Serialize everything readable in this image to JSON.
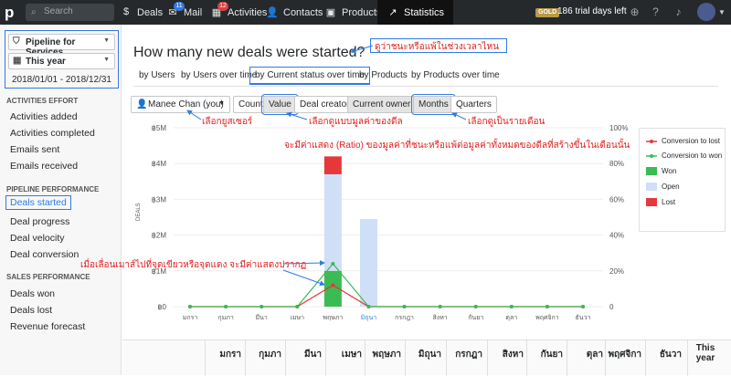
{
  "topbar": {
    "search_placeholder": "Search",
    "nav": [
      {
        "label": "Deals",
        "icon": "dollar-icon"
      },
      {
        "label": "Mail",
        "icon": "mail-icon",
        "badge": "11"
      },
      {
        "label": "Activities",
        "icon": "calendar-icon",
        "badge": "12"
      },
      {
        "label": "Contacts",
        "icon": "contacts-icon"
      },
      {
        "label": "Products",
        "icon": "box-icon"
      },
      {
        "label": "Statistics",
        "icon": "chart-icon"
      }
    ],
    "gold_label": "GOLD",
    "trial_text": "186 trial days left"
  },
  "sidebar": {
    "pipeline": "Pipeline for Services",
    "period": "This year",
    "date_range": "2018/01/01 - 2018/12/31",
    "sections": [
      {
        "title": "ACTIVITIES EFFORT",
        "items": [
          "Activities added",
          "Activities completed",
          "Emails sent",
          "Emails received"
        ]
      },
      {
        "title": "PIPELINE PERFORMANCE",
        "items": [
          "Deals started",
          "Deal progress",
          "Deal velocity",
          "Deal conversion"
        ]
      },
      {
        "title": "SALES PERFORMANCE",
        "items": [
          "Deals won",
          "Deals lost",
          "Revenue forecast"
        ]
      }
    ]
  },
  "main": {
    "title": "How many new deals were started?",
    "tabs": [
      "by Users",
      "by Users over time",
      "by Current status over time",
      "by Products",
      "by Products over time"
    ],
    "user_select": "Manee Chan (you)",
    "buttons": [
      "Count",
      "Value",
      "Deal creator",
      "Current owner",
      "Months",
      "Quarters"
    ]
  },
  "annotations": {
    "tab_note": "ดูว่าชนะหรือแพ้ในช่วงเวลาไหน",
    "user_note": "เลือกยูสเซอร์",
    "value_note": "เลือกดูแบบมูลค่าของดีล",
    "months_note": "เลือกดูเป็นรายเดือน",
    "ratio_note": "จะมีค่าแสดง (Ratio) ของมูลค่าที่ชนะหรือแพ้ต่อมูลค่าทั้งหมดของดีลที่สร้างขึ้นในเดือนนั้น",
    "hover_note": "เมื่อเลื่อนเมาส์ไปที่จุดเขียวหรือจุดแดง จะมีค่าแสดงปรากฏ"
  },
  "chart_data": {
    "type": "bar",
    "categories": [
      "มกรา",
      "กุมภา",
      "มีนา",
      "เมษา",
      "พฤษภา",
      "มิถุนา",
      "กรกฎา",
      "สิงหา",
      "กันยา",
      "ตุลา",
      "พฤศจิกา",
      "ธันวา"
    ],
    "ylabel": "DEALS",
    "y_ticks": [
      "฿0",
      "฿1M",
      "฿2M",
      "฿3M",
      "฿4M",
      "฿5M"
    ],
    "ylim": [
      0,
      5000000
    ],
    "y2_ticks": [
      "0",
      "20%",
      "40%",
      "60%",
      "80%",
      "100%"
    ],
    "y2lim": [
      0,
      100
    ],
    "series": [
      {
        "name": "Won",
        "kind": "bar",
        "color": "#3cba54",
        "values": [
          0,
          0,
          0,
          0,
          1000000,
          0,
          0,
          0,
          0,
          0,
          0,
          0
        ]
      },
      {
        "name": "Open",
        "kind": "bar",
        "color": "#cfdff7",
        "values": [
          0,
          0,
          0,
          0,
          2700000,
          2450000,
          0,
          0,
          0,
          0,
          0,
          0
        ]
      },
      {
        "name": "Lost",
        "kind": "bar",
        "color": "#e5383b",
        "values": [
          0,
          0,
          0,
          0,
          500000,
          0,
          0,
          0,
          0,
          0,
          0,
          0
        ]
      },
      {
        "name": "Conversion to lost",
        "kind": "line",
        "color": "#e5383b",
        "values": [
          0,
          0,
          0,
          0,
          12,
          0,
          0,
          0,
          0,
          0,
          0,
          0
        ]
      },
      {
        "name": "Conversion to won",
        "kind": "line",
        "color": "#3cba54",
        "values": [
          0,
          0,
          0,
          0,
          24,
          0,
          0,
          0,
          0,
          0,
          0,
          0
        ]
      }
    ],
    "legend_position": "right"
  },
  "table": {
    "headers": [
      "มกรา",
      "กุมภา",
      "มีนา",
      "เมษา",
      "พฤษภา",
      "มิถุนา",
      "กรกฎา",
      "สิงหา",
      "กันยา",
      "ตุลา",
      "พฤศจิกา",
      "ธันวา",
      "This year"
    ]
  }
}
